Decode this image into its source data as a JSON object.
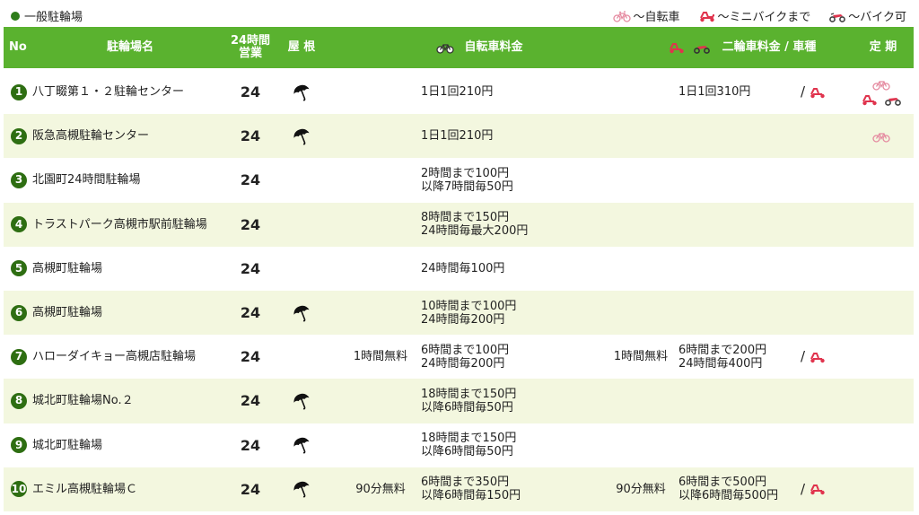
{
  "section_label": "一般駐輪場",
  "legend": [
    {
      "icon": "bicycle-icon",
      "label": "～自転車"
    },
    {
      "icon": "minibike-icon",
      "label": "～ミニバイクまで"
    },
    {
      "icon": "motorbike-icon",
      "label": "～バイク可"
    }
  ],
  "colors": {
    "header": "#5ab22f",
    "alt_row": "#f3f7df",
    "number_badge": "#2e6e12",
    "minibike": "#e0334d",
    "motorbike": "#e0334d"
  },
  "headers": {
    "no": "No",
    "name": "駐輪場名",
    "open24_line1": "24時間",
    "open24_line2": "営業",
    "roof": "屋 根",
    "bicycle_fee": "自転車料金",
    "moto_fee": "二輪車料金 / 車種",
    "teiki": "定 期"
  },
  "rows": [
    {
      "no": "1",
      "name": "八丁畷第１・２駐輪センター",
      "h24": "24",
      "roof": true,
      "bfree": "",
      "bprice": [
        "1日1回210円"
      ],
      "mfree": "",
      "mprice": [
        "1日1回310円"
      ],
      "slash": "/",
      "moto_icon": true,
      "teiki_bicycle": true,
      "teiki_moto": true
    },
    {
      "no": "2",
      "name": "阪急高槻駐輪センター",
      "h24": "24",
      "roof": true,
      "bfree": "",
      "bprice": [
        "1日1回210円"
      ],
      "mfree": "",
      "mprice": [],
      "slash": "",
      "moto_icon": false,
      "teiki_bicycle": true,
      "teiki_moto": false
    },
    {
      "no": "3",
      "name": "北園町24時間駐輪場",
      "h24": "24",
      "roof": false,
      "bfree": "",
      "bprice": [
        "2時間まで100円",
        "以降7時間毎50円"
      ],
      "mfree": "",
      "mprice": [],
      "slash": "",
      "moto_icon": false,
      "teiki_bicycle": false,
      "teiki_moto": false
    },
    {
      "no": "4",
      "name": "トラストパーク高槻市駅前駐輪場",
      "h24": "24",
      "roof": false,
      "bfree": "",
      "bprice": [
        "8時間まで150円",
        "24時間毎最大200円"
      ],
      "mfree": "",
      "mprice": [],
      "slash": "",
      "moto_icon": false,
      "teiki_bicycle": false,
      "teiki_moto": false
    },
    {
      "no": "5",
      "name": "高槻町駐輪場",
      "h24": "24",
      "roof": false,
      "bfree": "",
      "bprice": [
        "24時間毎100円"
      ],
      "mfree": "",
      "mprice": [],
      "slash": "",
      "moto_icon": false,
      "teiki_bicycle": false,
      "teiki_moto": false
    },
    {
      "no": "6",
      "name": "高槻町駐輪場",
      "h24": "24",
      "roof": true,
      "bfree": "",
      "bprice": [
        "10時間まで100円",
        "24時間毎200円"
      ],
      "mfree": "",
      "mprice": [],
      "slash": "",
      "moto_icon": false,
      "teiki_bicycle": false,
      "teiki_moto": false
    },
    {
      "no": "7",
      "name": "ハローダイキョー高槻店駐輪場",
      "h24": "24",
      "roof": false,
      "bfree": "1時間無料",
      "bprice": [
        "6時間まで100円",
        "24時間毎200円"
      ],
      "mfree": "1時間無料",
      "mprice": [
        "6時間まで200円",
        "24時間毎400円"
      ],
      "slash": "/",
      "moto_icon": true,
      "teiki_bicycle": false,
      "teiki_moto": false
    },
    {
      "no": "8",
      "name": "城北町駐輪場No.２",
      "h24": "24",
      "roof": true,
      "bfree": "",
      "bprice": [
        "18時間まで150円",
        "以降6時間毎50円"
      ],
      "mfree": "",
      "mprice": [],
      "slash": "",
      "moto_icon": false,
      "teiki_bicycle": false,
      "teiki_moto": false
    },
    {
      "no": "9",
      "name": "城北町駐輪場",
      "h24": "24",
      "roof": true,
      "bfree": "",
      "bprice": [
        "18時間まで150円",
        "以降6時間毎50円"
      ],
      "mfree": "",
      "mprice": [],
      "slash": "",
      "moto_icon": false,
      "teiki_bicycle": false,
      "teiki_moto": false
    },
    {
      "no": "10",
      "name": "エミル高槻駐輪場Ｃ",
      "h24": "24",
      "roof": true,
      "bfree": "90分無料",
      "bprice": [
        "6時間まで350円",
        "以降6時間毎150円"
      ],
      "mfree": "90分無料",
      "mprice": [
        "6時間まで500円",
        "以降6時間毎500円"
      ],
      "slash": "/",
      "moto_icon": true,
      "teiki_bicycle": false,
      "teiki_moto": false
    }
  ]
}
